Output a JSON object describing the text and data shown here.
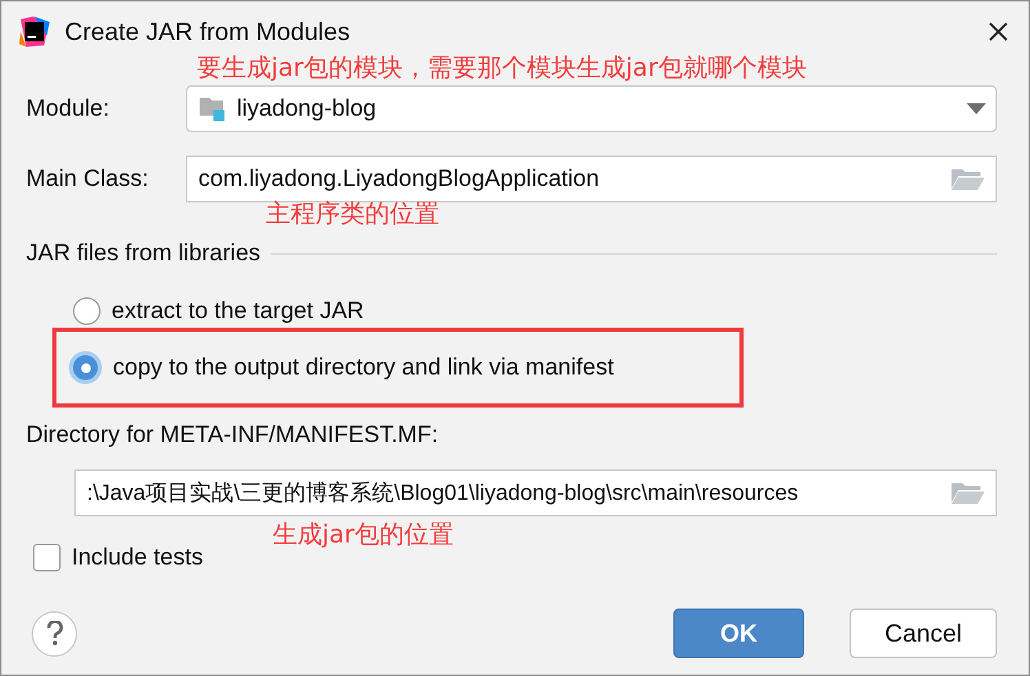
{
  "window": {
    "title": "Create JAR from Modules"
  },
  "module": {
    "label": "Module:",
    "value": "liyadong-blog",
    "annotation": "要生成jar包的模块，需要那个模块生成jar包就哪个模块"
  },
  "main_class": {
    "label": "Main Class:",
    "value": "com.liyadong.LiyadongBlogApplication",
    "annotation": "主程序类的位置"
  },
  "libraries": {
    "title": "JAR files from libraries",
    "options": [
      {
        "label": "extract to the target JAR",
        "selected": false,
        "highlighted": false
      },
      {
        "label": "copy to the output directory and link via manifest",
        "selected": true,
        "highlighted": true
      }
    ]
  },
  "manifest": {
    "label": "Directory for META-INF/MANIFEST.MF:",
    "value": ":\\Java项目实战\\三更的博客系统\\Blog01\\liyadong-blog\\src\\main\\resources",
    "annotation": "生成jar包的位置"
  },
  "include_tests": {
    "label": "Include tests",
    "checked": false
  },
  "buttons": [
    {
      "label": "OK",
      "kind": "primary"
    },
    {
      "label": "Cancel",
      "kind": "secondary"
    }
  ]
}
